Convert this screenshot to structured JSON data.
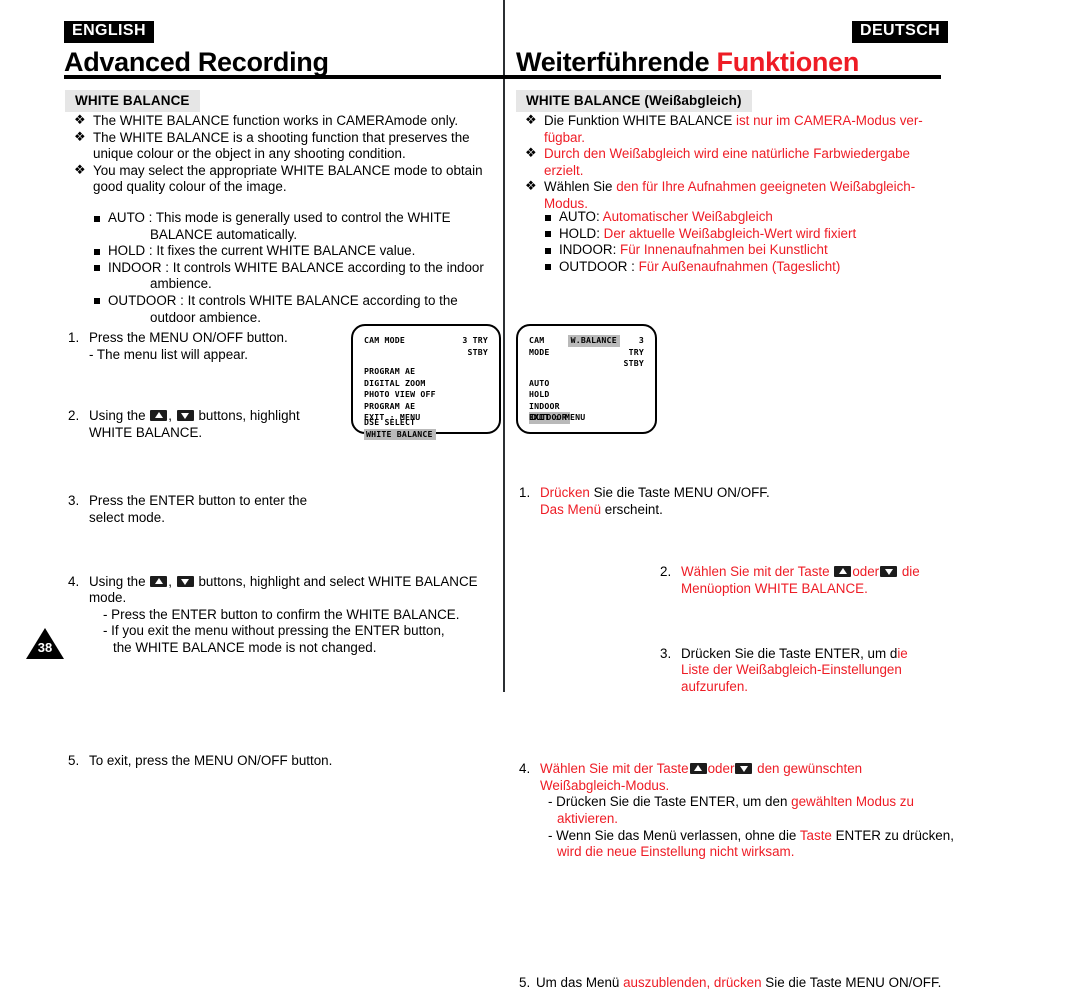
{
  "header": {
    "left_lang": "ENGLISH",
    "right_lang": "DEUTSCH",
    "left_title": "Advanced Recording",
    "right_title_main": "Weiterführende ",
    "right_title_accent": "Funktionen",
    "accent_color": "#ee1c25"
  },
  "page_number": "38",
  "english": {
    "section_title": "WHITE BALANCE",
    "bullets": [
      "The WHITE BALANCE function works in CAMERAmode only.",
      "The WHITE BALANCE is a shooting function that preserves the unique colour or the object in any shooting condition.",
      "You may select the appropriate WHITE BALANCE mode to obtain good quality colour of the image."
    ],
    "modes": [
      {
        "label": "AUTO : This mode is generally used to control the WHITE",
        "cont": "BALANCE automatically."
      },
      {
        "label": "HOLD : It fixes the current WHITE BALANCE value.",
        "cont": ""
      },
      {
        "label": "INDOOR : It controls WHITE BALANCE according to the indoor",
        "cont": "ambience."
      },
      {
        "label": "OUTDOOR : It controls WHITE BALANCE according to the",
        "cont": "outdoor ambience."
      }
    ],
    "steps": {
      "s1_num": "1.",
      "s1_text": "Press the MENU ON/OFF button.",
      "s1_sub": "- The menu list will appear.",
      "s2_num": "2.",
      "s2_pre": "Using the ",
      "s2_mid": ", ",
      "s2_post": " buttons, highlight",
      "s2_line2": "WHITE BALANCE.",
      "s3_num": "3.",
      "s3_text": "Press the ENTER button to enter the",
      "s3_line2": "select mode.",
      "s4_num": "4.",
      "s4_pre": "Using the ",
      "s4_mid": ", ",
      "s4_post": " buttons, highlight and select WHITE BALANCE",
      "s4_line2": "mode.",
      "s4_sub1": "- Press the ENTER button to confirm the WHITE BALANCE.",
      "s4_sub2": "- If you exit the menu without pressing the ENTER button,",
      "s4_sub3": "the WHITE BALANCE mode is not changed.",
      "s5_num": "5.",
      "s5_text": "To exit, press the MENU ON/OFF button."
    }
  },
  "german": {
    "section_title": "WHITE BALANCE (Weißabgleich)",
    "bullets": [
      {
        "black": "Die Funktion WHITE BALANCE ",
        "red": "ist nur im CAMERA-Modus ver-",
        "red2": "fügbar."
      },
      {
        "black": "",
        "red": "Durch den Weißabgleich wird eine natürliche Farbwiedergabe",
        "red2": "erzielt."
      },
      {
        "black": "Wählen Sie ",
        "red": "den für Ihre Aufnahmen geeigneten Weißabgleich-",
        "red2": "Modus."
      }
    ],
    "modes": [
      {
        "black": "AUTO: ",
        "red": "Automatischer Weißabgleich"
      },
      {
        "black": "HOLD: ",
        "red": "Der aktuelle Weißabgleich-Wert wird fixiert"
      },
      {
        "black": "INDOOR: ",
        "red": "Für Innenaufnahmen bei Kunstlicht"
      },
      {
        "black": "OUTDOOR : ",
        "red": "Für Außenaufnahmen (Tageslicht)"
      }
    ],
    "steps": {
      "s1_num": "1.",
      "s1_red": "Drücken",
      "s1_black": " Sie die Taste MENU ON/OFF.",
      "s1_sub_red": "Das Menü",
      "s1_sub_black": " erscheint.",
      "s2_num": "2.",
      "s2_pre": "Wählen Sie mit der Taste ",
      "s2_mid": "oder",
      "s2_post": " die",
      "s2_line2": "Menüoption WHITE BALANCE.",
      "s3_num": "3.",
      "s3_black": "Drücken Sie die Taste ENTER, um d",
      "s3_red": "ie",
      "s3_line2": "Liste der Weißabgleich-Einstellungen",
      "s3_line3": "aufzurufen.",
      "s4_num": "4.",
      "s4_pre": "Wählen Sie mit der Taste",
      "s4_mid": "oder",
      "s4_post": " den gewünschten",
      "s4_line2": "Weißabgleich-Modus.",
      "s4_sub1_black": "- Drücken Sie die Taste ENTER, um den ",
      "s4_sub1_red": "gewählten Modus zu",
      "s4_sub1_red2": "aktivieren.",
      "s4_sub2_black": "- Wenn Sie das Menü verlassen, ohne die ",
      "s4_sub2_red": "Taste",
      "s4_sub2_black2": " ENTER zu drücken,",
      "s4_sub2_red2": "wird die neue Einstellung nicht wirksam.",
      "s5_num": "5.",
      "s5_black1": "Um das Menü ",
      "s5_red": "auszublenden, drücken",
      "s5_black2": " Sie die Taste MENU ON/OFF."
    }
  },
  "lcd_menu": {
    "header_left": "CAM MODE",
    "header_right_1": "3 TRY",
    "header_right_2": "STBY",
    "items": [
      "PROGRAM AE",
      "DIGITAL ZOOM",
      "PHOTO VIEW OFF",
      "PROGRAM AE"
    ],
    "items_b": [
      "DSE SELECT",
      "WHITE BALANCE"
    ],
    "footer": "EXIT : MENU"
  },
  "lcd_submenu": {
    "header_left": "CAM MODE",
    "header_title": "W.BALANCE",
    "header_right_1": "3 TRY",
    "header_right_2": "STBY",
    "items": [
      "AUTO",
      "HOLD",
      "INDOOR"
    ],
    "selected": "OUTDOOR",
    "footer": "EXIT : MENU"
  }
}
